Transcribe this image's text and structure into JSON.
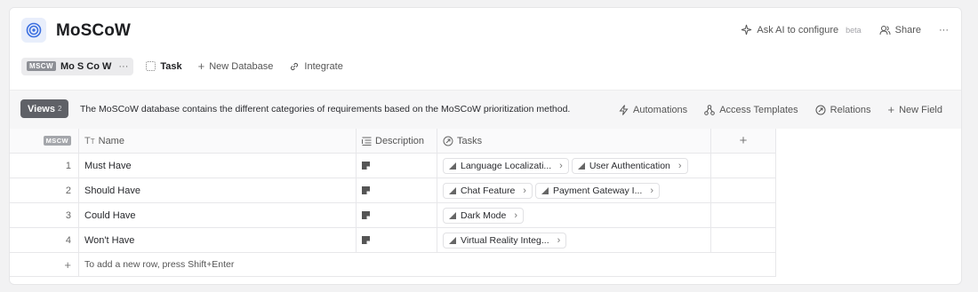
{
  "app": {
    "title": "MoSCoW",
    "ask_ai_label": "Ask AI to configure",
    "beta_label": "beta",
    "share_label": "Share",
    "more_label": "···"
  },
  "tabs": [
    {
      "badge": "MSCW",
      "label": "Mo S Co W",
      "more": "···"
    },
    {
      "label": "Task"
    },
    {
      "label": "New Database"
    },
    {
      "label": "Integrate"
    }
  ],
  "toolbar": {
    "views_label": "Views",
    "views_count": "2",
    "description": "The MoSCoW database contains the different categories of requirements based on the MoSCoW prioritization method.",
    "automations_label": "Automations",
    "access_templates_label": "Access Templates",
    "relations_label": "Relations",
    "new_field_label": "New Field"
  },
  "table": {
    "header_badge": "MSCW",
    "columns": [
      "Name",
      "Description",
      "Tasks"
    ],
    "add_column": "+",
    "rows": [
      {
        "index": "1",
        "name": "Must Have",
        "tasks": [
          "Language Localizati...",
          "User Authentication"
        ]
      },
      {
        "index": "2",
        "name": "Should Have",
        "tasks": [
          "Chat Feature",
          "Payment Gateway I..."
        ]
      },
      {
        "index": "3",
        "name": "Could Have",
        "tasks": [
          "Dark Mode"
        ]
      },
      {
        "index": "4",
        "name": "Won't Have",
        "tasks": [
          "Virtual Reality Integ..."
        ]
      }
    ],
    "add_row_plus": "+",
    "add_row_hint": "To add a new row, press Shift+Enter"
  },
  "colors": {
    "accent": "#3b6fe0",
    "views_button": "#5f6167"
  }
}
